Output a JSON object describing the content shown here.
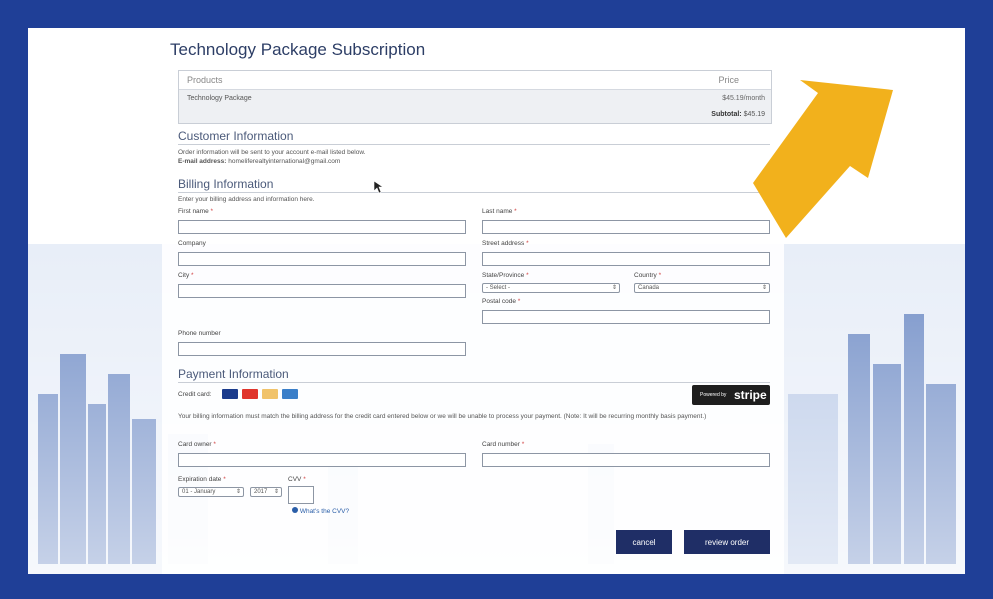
{
  "page": {
    "title": "Technology Package Subscription"
  },
  "products": {
    "header_product": "Products",
    "header_price": "Price",
    "rows": [
      {
        "name": "Technology Package",
        "price": "$45.19/month"
      }
    ],
    "subtotal_label": "Subtotal:",
    "subtotal_value": "$45.19"
  },
  "customer": {
    "heading": "Customer Information",
    "note": "Order information will be sent to your account e-mail listed below.",
    "email_label": "E-mail address:",
    "email_value": "homeliferealtyinternational@gmail.com"
  },
  "billing": {
    "heading": "Billing Information",
    "note": "Enter your billing address and information here.",
    "first_name": "First name",
    "last_name": "Last name",
    "company": "Company",
    "street": "Street address",
    "city": "City",
    "state": "State/Province",
    "state_value": "- Select -",
    "country": "Country",
    "country_value": "Canada",
    "postal": "Postal code",
    "phone": "Phone number",
    "required_mark": "*"
  },
  "payment": {
    "heading": "Payment Information",
    "credit_card_label": "Credit card:",
    "stripe_powered": "Powered by",
    "stripe_brand": "stripe",
    "notice": "Your billing information must match the billing address for the credit card entered below or we will be unable to process your payment. (Note: It will be recurring monthly basis payment.)",
    "card_owner": "Card owner",
    "card_number": "Card number",
    "expiration": "Expiration date",
    "exp_month": "01 - January",
    "exp_year": "2017",
    "cvv": "CVV",
    "whats_cvv": "What's the CVV?"
  },
  "actions": {
    "cancel": "cancel",
    "review": "review order"
  },
  "colors": {
    "frame": "#1f3f97",
    "button": "#1f2e66",
    "arrow": "#f2b11c"
  }
}
